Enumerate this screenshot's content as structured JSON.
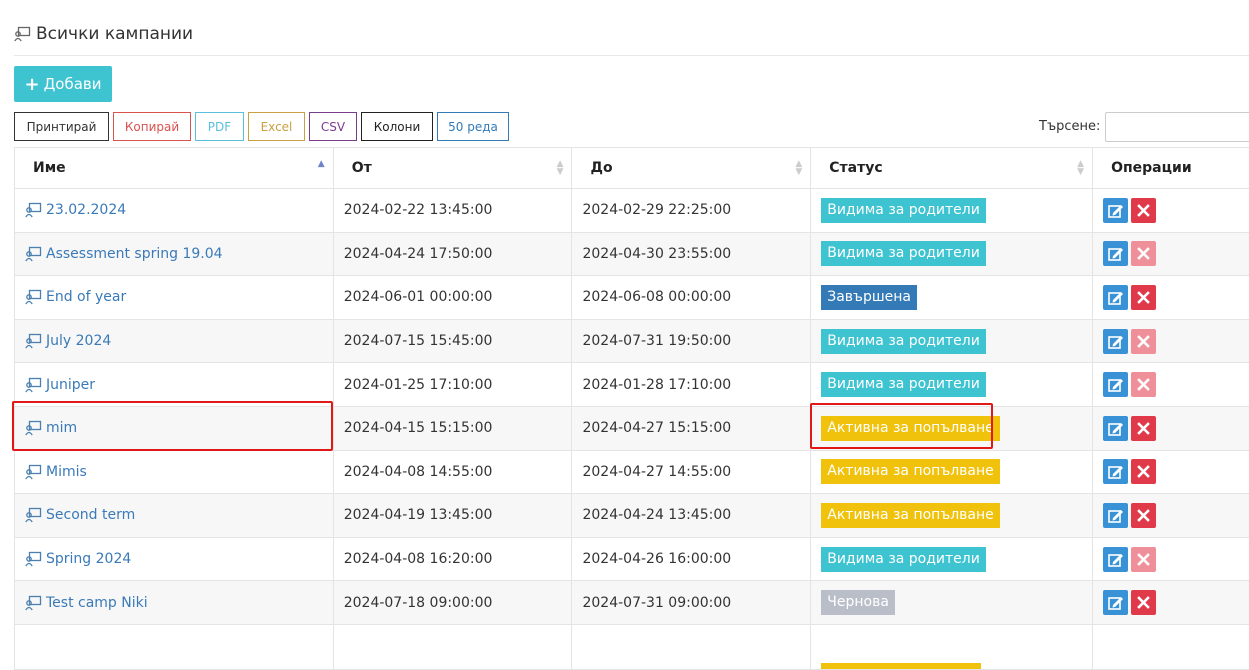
{
  "page": {
    "title": "Всички кампании"
  },
  "toolbar": {
    "add_label": "Добави",
    "buttons": [
      {
        "label": "Принтирай",
        "color": "#333333"
      },
      {
        "label": "Копирай",
        "color": "#d9534f"
      },
      {
        "label": "PDF",
        "color": "#5bc0de"
      },
      {
        "label": "Excel",
        "color": "#c9a043"
      },
      {
        "label": "CSV",
        "color": "#7a3c8c"
      },
      {
        "label": "Колони",
        "color": "#222222"
      },
      {
        "label": "50 реда",
        "color": "#337ab7"
      }
    ],
    "search_label": "Търсене:",
    "search_value": ""
  },
  "table": {
    "headers": [
      "Име",
      "От",
      "До",
      "Статус",
      "Операции"
    ],
    "rows": [
      {
        "name": "23.02.2024",
        "from": "2024-02-22 13:45:00",
        "to": "2024-02-29 22:25:00",
        "status": "Видима за родители",
        "status_type": "visible",
        "delete_enabled": true
      },
      {
        "name": "Assessment spring 19.04",
        "from": "2024-04-24 17:50:00",
        "to": "2024-04-30 23:55:00",
        "status": "Видима за родители",
        "status_type": "visible",
        "delete_enabled": false
      },
      {
        "name": "End of year",
        "from": "2024-06-01 00:00:00",
        "to": "2024-06-08 00:00:00",
        "status": "Завършена",
        "status_type": "finished",
        "delete_enabled": true
      },
      {
        "name": "July 2024",
        "from": "2024-07-15 15:45:00",
        "to": "2024-07-31 19:50:00",
        "status": "Видима за родители",
        "status_type": "visible",
        "delete_enabled": false
      },
      {
        "name": "Juniper",
        "from": "2024-01-25 17:10:00",
        "to": "2024-01-28 17:10:00",
        "status": "Видима за родители",
        "status_type": "visible",
        "delete_enabled": false
      },
      {
        "name": "mim",
        "from": "2024-04-15 15:15:00",
        "to": "2024-04-27 15:15:00",
        "status": "Активна за попълване",
        "status_type": "active",
        "delete_enabled": true
      },
      {
        "name": "Mimis",
        "from": "2024-04-08 14:55:00",
        "to": "2024-04-27 14:55:00",
        "status": "Активна за попълване",
        "status_type": "active",
        "delete_enabled": true
      },
      {
        "name": "Second term",
        "from": "2024-04-19 13:45:00",
        "to": "2024-04-24 13:45:00",
        "status": "Активна за попълване",
        "status_type": "active",
        "delete_enabled": true
      },
      {
        "name": "Spring 2024",
        "from": "2024-04-08 16:20:00",
        "to": "2024-04-26 16:00:00",
        "status": "Видима за родители",
        "status_type": "visible",
        "delete_enabled": false
      },
      {
        "name": "Test camp Niki",
        "from": "2024-07-18 09:00:00",
        "to": "2024-07-31 09:00:00",
        "status": "Чернова",
        "status_type": "draft",
        "delete_enabled": true
      },
      {
        "name": "",
        "from": "",
        "to": "",
        "status": "",
        "status_type": "active",
        "delete_enabled": true
      }
    ]
  },
  "colors": {
    "visible": "#3ec3d1",
    "finished": "#337ab7",
    "active": "#f0c20c",
    "draft": "#b9bec8",
    "edit": "#3a92d6",
    "delete": "#e0394a",
    "delete_disabled": "#ee8f99",
    "link": "#3a7ab8",
    "highlight": "#e01818"
  },
  "icons": {
    "campaign": "campaign-icon",
    "edit": "edit-icon",
    "delete": "delete-icon",
    "add": "plus-icon"
  }
}
